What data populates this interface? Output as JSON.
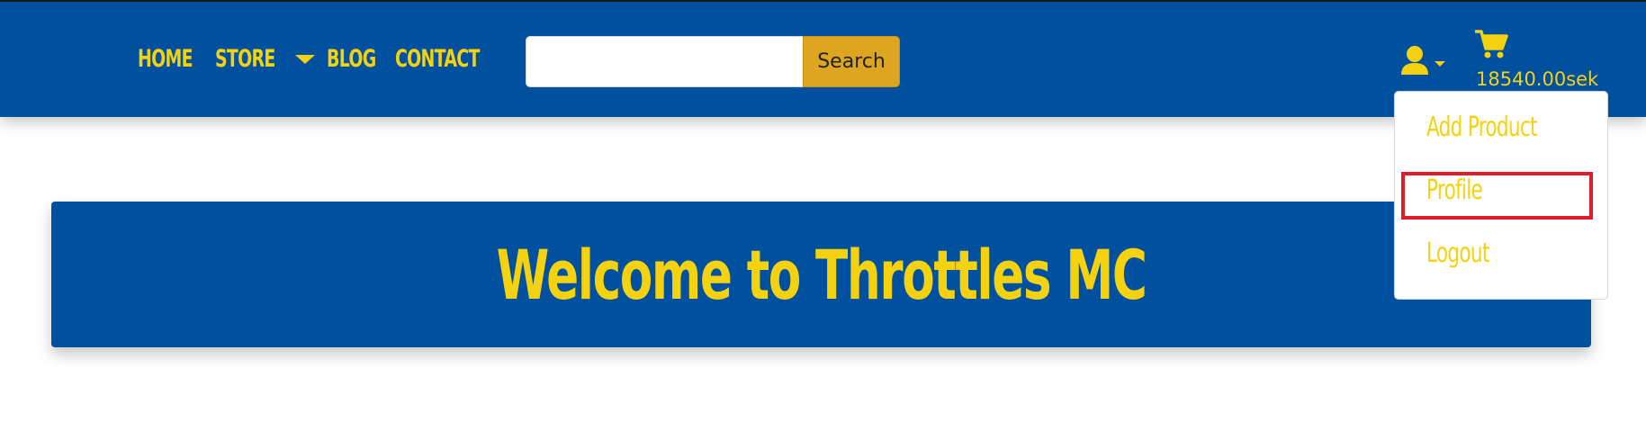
{
  "navbar": {
    "links": [
      {
        "label": "HOME"
      },
      {
        "label": "STORE"
      },
      {
        "label": "BLOG"
      },
      {
        "label": "CONTACT"
      }
    ],
    "search": {
      "value": "",
      "placeholder": "",
      "button_label": "Search"
    },
    "cart_total": "18540.00sek"
  },
  "user_menu": {
    "items": [
      {
        "label": "Add Product"
      },
      {
        "label": "Profile"
      },
      {
        "label": "Logout"
      }
    ]
  },
  "hero": {
    "title": "Welcome to Throttles MC"
  },
  "icons": [
    "chevron-down-icon",
    "user-icon",
    "cart-icon"
  ],
  "colors": {
    "primary": "#0050a0",
    "accent": "#f5d20f",
    "search_button": "#dda520",
    "highlight": "#e21b2a"
  }
}
